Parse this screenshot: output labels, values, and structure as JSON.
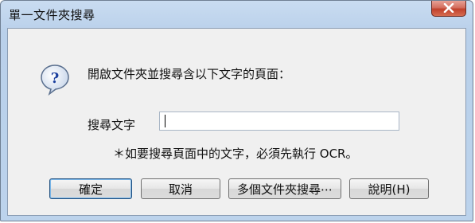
{
  "window": {
    "title": "單一文件夾搜尋"
  },
  "icons": {
    "close": "close-icon",
    "question": "question-icon"
  },
  "dialog": {
    "message": "開啟文件夾並搜尋含以下文字的頁面：",
    "search_label": "搜尋文字",
    "search_value": "",
    "note": "＊如要搜尋頁面中的文字，必須先執行 OCR。"
  },
  "buttons": {
    "ok": "確定",
    "cancel": "取消",
    "multi": "多個文件夾搜尋⋯",
    "help": "說明(H)"
  }
}
